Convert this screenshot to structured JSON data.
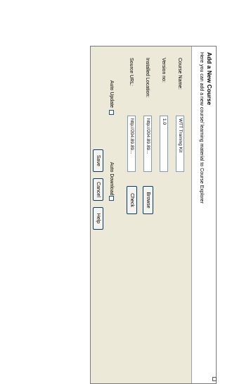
{
  "dialog": {
    "title": "Add a New Course",
    "subtitle": "Here you can add a new course/ learning material to Course Explorer"
  },
  "form": {
    "course_name_label": "Course Name:",
    "course_name_value": "WTT Training Kit",
    "version_label": "Version no:",
    "version_value": "1.0",
    "installed_location_label": "Installed Location:",
    "installed_location_value": "http://204.89.89...",
    "browse_label": "Browse",
    "source_url_label": "Source URL:",
    "source_url_value": "http://204.89.89...",
    "check_label": "Check",
    "auto_update_label": "Auto Update",
    "auto_download_label": "Auto Download"
  },
  "buttons": {
    "save_label": "Save",
    "cancel_label": "Cancel",
    "help_label": "Help"
  }
}
